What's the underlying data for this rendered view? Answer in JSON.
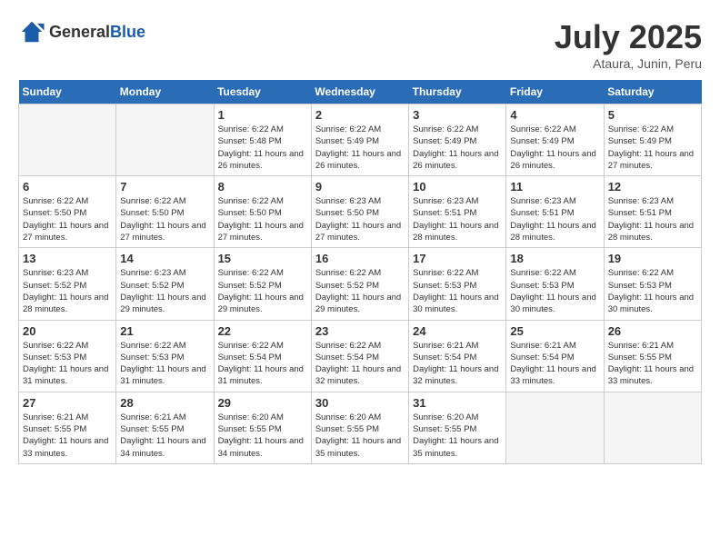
{
  "header": {
    "logo_general": "General",
    "logo_blue": "Blue",
    "title": "July 2025",
    "location": "Ataura, Junin, Peru"
  },
  "weekdays": [
    "Sunday",
    "Monday",
    "Tuesday",
    "Wednesday",
    "Thursday",
    "Friday",
    "Saturday"
  ],
  "weeks": [
    [
      {
        "day": "",
        "empty": true
      },
      {
        "day": "",
        "empty": true
      },
      {
        "day": "1",
        "sunrise": "6:22 AM",
        "sunset": "5:48 PM",
        "daylight": "11 hours and 26 minutes."
      },
      {
        "day": "2",
        "sunrise": "6:22 AM",
        "sunset": "5:49 PM",
        "daylight": "11 hours and 26 minutes."
      },
      {
        "day": "3",
        "sunrise": "6:22 AM",
        "sunset": "5:49 PM",
        "daylight": "11 hours and 26 minutes."
      },
      {
        "day": "4",
        "sunrise": "6:22 AM",
        "sunset": "5:49 PM",
        "daylight": "11 hours and 26 minutes."
      },
      {
        "day": "5",
        "sunrise": "6:22 AM",
        "sunset": "5:49 PM",
        "daylight": "11 hours and 27 minutes."
      }
    ],
    [
      {
        "day": "6",
        "sunrise": "6:22 AM",
        "sunset": "5:50 PM",
        "daylight": "11 hours and 27 minutes."
      },
      {
        "day": "7",
        "sunrise": "6:22 AM",
        "sunset": "5:50 PM",
        "daylight": "11 hours and 27 minutes."
      },
      {
        "day": "8",
        "sunrise": "6:22 AM",
        "sunset": "5:50 PM",
        "daylight": "11 hours and 27 minutes."
      },
      {
        "day": "9",
        "sunrise": "6:23 AM",
        "sunset": "5:50 PM",
        "daylight": "11 hours and 27 minutes."
      },
      {
        "day": "10",
        "sunrise": "6:23 AM",
        "sunset": "5:51 PM",
        "daylight": "11 hours and 28 minutes."
      },
      {
        "day": "11",
        "sunrise": "6:23 AM",
        "sunset": "5:51 PM",
        "daylight": "11 hours and 28 minutes."
      },
      {
        "day": "12",
        "sunrise": "6:23 AM",
        "sunset": "5:51 PM",
        "daylight": "11 hours and 28 minutes."
      }
    ],
    [
      {
        "day": "13",
        "sunrise": "6:23 AM",
        "sunset": "5:52 PM",
        "daylight": "11 hours and 28 minutes."
      },
      {
        "day": "14",
        "sunrise": "6:23 AM",
        "sunset": "5:52 PM",
        "daylight": "11 hours and 29 minutes."
      },
      {
        "day": "15",
        "sunrise": "6:22 AM",
        "sunset": "5:52 PM",
        "daylight": "11 hours and 29 minutes."
      },
      {
        "day": "16",
        "sunrise": "6:22 AM",
        "sunset": "5:52 PM",
        "daylight": "11 hours and 29 minutes."
      },
      {
        "day": "17",
        "sunrise": "6:22 AM",
        "sunset": "5:53 PM",
        "daylight": "11 hours and 30 minutes."
      },
      {
        "day": "18",
        "sunrise": "6:22 AM",
        "sunset": "5:53 PM",
        "daylight": "11 hours and 30 minutes."
      },
      {
        "day": "19",
        "sunrise": "6:22 AM",
        "sunset": "5:53 PM",
        "daylight": "11 hours and 30 minutes."
      }
    ],
    [
      {
        "day": "20",
        "sunrise": "6:22 AM",
        "sunset": "5:53 PM",
        "daylight": "11 hours and 31 minutes."
      },
      {
        "day": "21",
        "sunrise": "6:22 AM",
        "sunset": "5:53 PM",
        "daylight": "11 hours and 31 minutes."
      },
      {
        "day": "22",
        "sunrise": "6:22 AM",
        "sunset": "5:54 PM",
        "daylight": "11 hours and 31 minutes."
      },
      {
        "day": "23",
        "sunrise": "6:22 AM",
        "sunset": "5:54 PM",
        "daylight": "11 hours and 32 minutes."
      },
      {
        "day": "24",
        "sunrise": "6:21 AM",
        "sunset": "5:54 PM",
        "daylight": "11 hours and 32 minutes."
      },
      {
        "day": "25",
        "sunrise": "6:21 AM",
        "sunset": "5:54 PM",
        "daylight": "11 hours and 33 minutes."
      },
      {
        "day": "26",
        "sunrise": "6:21 AM",
        "sunset": "5:55 PM",
        "daylight": "11 hours and 33 minutes."
      }
    ],
    [
      {
        "day": "27",
        "sunrise": "6:21 AM",
        "sunset": "5:55 PM",
        "daylight": "11 hours and 33 minutes."
      },
      {
        "day": "28",
        "sunrise": "6:21 AM",
        "sunset": "5:55 PM",
        "daylight": "11 hours and 34 minutes."
      },
      {
        "day": "29",
        "sunrise": "6:20 AM",
        "sunset": "5:55 PM",
        "daylight": "11 hours and 34 minutes."
      },
      {
        "day": "30",
        "sunrise": "6:20 AM",
        "sunset": "5:55 PM",
        "daylight": "11 hours and 35 minutes."
      },
      {
        "day": "31",
        "sunrise": "6:20 AM",
        "sunset": "5:55 PM",
        "daylight": "11 hours and 35 minutes."
      },
      {
        "day": "",
        "empty": true
      },
      {
        "day": "",
        "empty": true
      }
    ]
  ]
}
